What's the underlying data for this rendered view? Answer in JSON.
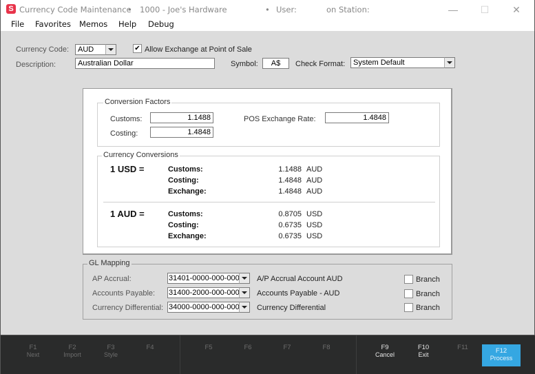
{
  "window": {
    "app_icon": "S",
    "title": "Currency Code Maintenance",
    "company": "1000 - Joe's Hardware",
    "user_label": "User:",
    "station_label": "on Station:",
    "separator": "•",
    "controls": {
      "minimize": "—",
      "maximize": "☐",
      "close": "✕"
    }
  },
  "menu": [
    "File",
    "Favorites",
    "Memos",
    "Help",
    "Debug"
  ],
  "header": {
    "currency_code_label": "Currency Code:",
    "currency_code_value": "AUD",
    "allow_exchange_label": "Allow Exchange at Point of Sale",
    "allow_exchange_checked": true,
    "check_mark": "✔",
    "description_label": "Description:",
    "description_value": "Australian Dollar",
    "symbol_label": "Symbol:",
    "symbol_value": "A$",
    "check_format_label": "Check Format:",
    "check_format_value": "System Default"
  },
  "conversion_factors": {
    "title": "Conversion Factors",
    "customs_label": "Customs:",
    "customs_value": "1.1488",
    "costing_label": "Costing:",
    "costing_value": "1.4848",
    "pos_rate_label": "POS Exchange Rate:",
    "pos_rate_value": "1.4848"
  },
  "currency_conversions": {
    "title": "Currency Conversions",
    "groups": [
      {
        "heading": "1 USD =",
        "rows": [
          {
            "label": "Customs:",
            "value": "1.1488",
            "currency": "AUD"
          },
          {
            "label": "Costing:",
            "value": "1.4848",
            "currency": "AUD"
          },
          {
            "label": "Exchange:",
            "value": "1.4848",
            "currency": "AUD"
          }
        ]
      },
      {
        "heading": "1 AUD =",
        "rows": [
          {
            "label": "Customs:",
            "value": "0.8705",
            "currency": "USD"
          },
          {
            "label": "Costing:",
            "value": "0.6735",
            "currency": "USD"
          },
          {
            "label": "Exchange:",
            "value": "0.6735",
            "currency": "USD"
          }
        ]
      }
    ]
  },
  "gl_mapping": {
    "title": "GL Mapping",
    "rows": [
      {
        "label": "AP Accrual:",
        "account": "31401-0000-000-000",
        "description": "A/P Accrual Account  AUD",
        "branch_label": "Branch",
        "branch_checked": false
      },
      {
        "label": "Accounts Payable:",
        "account": "31400-2000-000-000",
        "description": "Accounts Payable - AUD",
        "branch_label": "Branch",
        "branch_checked": false
      },
      {
        "label": "Currency Differential:",
        "account": "34000-0000-000-000",
        "description": "Currency Differential",
        "branch_label": "Branch",
        "branch_checked": false
      }
    ]
  },
  "function_keys": [
    {
      "key": "F1",
      "label": "Next",
      "enabled": false
    },
    {
      "key": "F2",
      "label": "Import",
      "enabled": false
    },
    {
      "key": "F3",
      "label": "Style",
      "enabled": false
    },
    {
      "key": "F4",
      "label": "",
      "enabled": false
    },
    {
      "key": "F5",
      "label": "",
      "enabled": false
    },
    {
      "key": "F6",
      "label": "",
      "enabled": false
    },
    {
      "key": "F7",
      "label": "",
      "enabled": false
    },
    {
      "key": "F8",
      "label": "",
      "enabled": false
    },
    {
      "key": "F9",
      "label": "Cancel",
      "enabled": true
    },
    {
      "key": "F10",
      "label": "Exit",
      "enabled": true
    },
    {
      "key": "F11",
      "label": "",
      "enabled": false
    },
    {
      "key": "F12",
      "label": "Process",
      "enabled": true,
      "primary": true
    }
  ],
  "colors": {
    "accent": "#35a7e2",
    "logo": "#e8334a",
    "footer_bg": "#2a2b2b",
    "window_bg": "#dcdcdc"
  }
}
